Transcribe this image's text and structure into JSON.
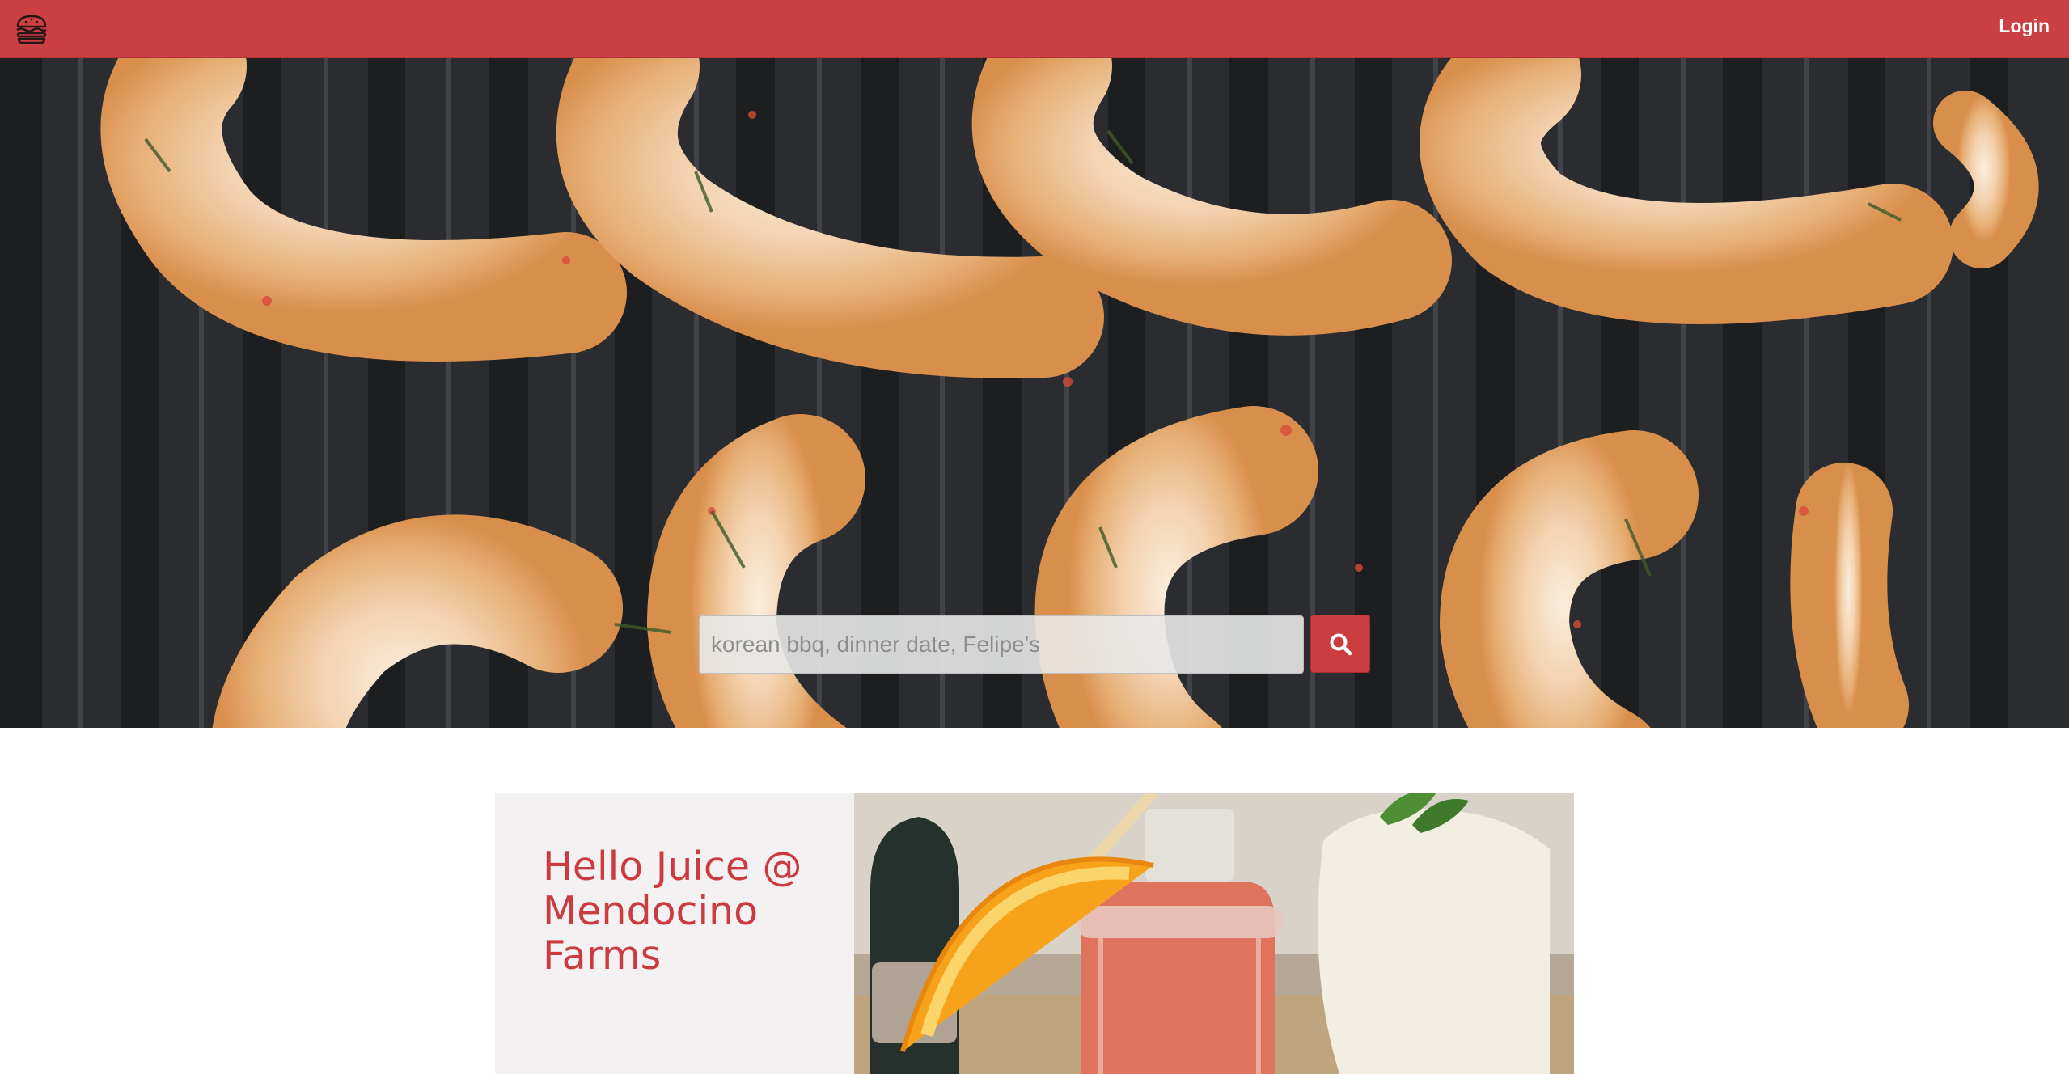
{
  "header": {
    "logo_icon": "burger-icon",
    "login_label": "Login",
    "brand_color": "#cb4044"
  },
  "hero": {
    "image": "grilled-shrimp-photo",
    "search": {
      "placeholder": "korean bbq, dinner date, Felipe's",
      "value": "",
      "button_icon": "search-icon"
    }
  },
  "featured": {
    "title": "Hello Juice @ Mendocino Farms",
    "image": "orange-juice-jar-photo",
    "title_color": "#cb3b40"
  }
}
